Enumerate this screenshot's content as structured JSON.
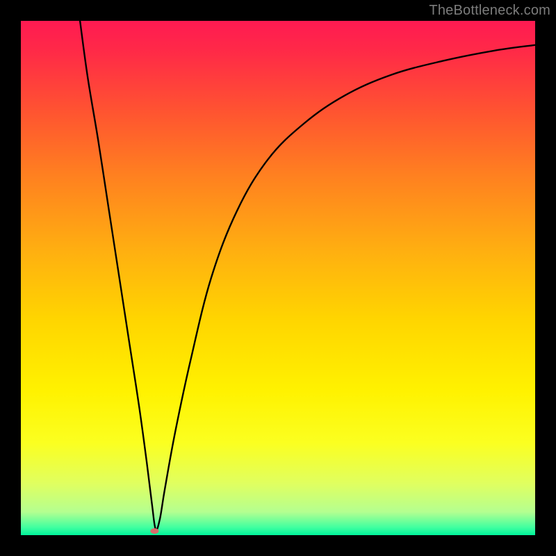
{
  "attribution": "TheBottleneck.com",
  "chart_data": {
    "type": "line",
    "title": "",
    "xlabel": "",
    "ylabel": "",
    "xlim": [
      0,
      100
    ],
    "ylim": [
      0,
      100
    ],
    "background_gradient_stops": [
      {
        "pos": 0.0,
        "color": "#ff1a52"
      },
      {
        "pos": 0.06,
        "color": "#ff2a47"
      },
      {
        "pos": 0.18,
        "color": "#ff5530"
      },
      {
        "pos": 0.3,
        "color": "#ff8020"
      },
      {
        "pos": 0.45,
        "color": "#ffb010"
      },
      {
        "pos": 0.58,
        "color": "#ffd500"
      },
      {
        "pos": 0.72,
        "color": "#fff200"
      },
      {
        "pos": 0.82,
        "color": "#fbff20"
      },
      {
        "pos": 0.9,
        "color": "#e0ff60"
      },
      {
        "pos": 0.955,
        "color": "#b4ff90"
      },
      {
        "pos": 0.985,
        "color": "#40ffa0"
      },
      {
        "pos": 1.0,
        "color": "#00f49b"
      }
    ],
    "series": [
      {
        "name": "bottleneck-curve",
        "type": "line",
        "x": [
          11.5,
          13,
          15,
          17,
          19,
          21,
          23,
          24.5,
          25.5,
          26.2,
          27,
          28,
          30,
          33,
          37,
          42,
          48,
          55,
          63,
          72,
          82,
          92,
          100
        ],
        "y": [
          100,
          89,
          77,
          64,
          51,
          38,
          25,
          14,
          6,
          1.2,
          3,
          9,
          20,
          34,
          50,
          63,
          73,
          80,
          85.5,
          89.5,
          92.2,
          94.2,
          95.3
        ]
      }
    ],
    "marker": {
      "x": 26.0,
      "y": 0.8,
      "color": "#d96b6b",
      "rx": 6,
      "ry": 4
    }
  }
}
